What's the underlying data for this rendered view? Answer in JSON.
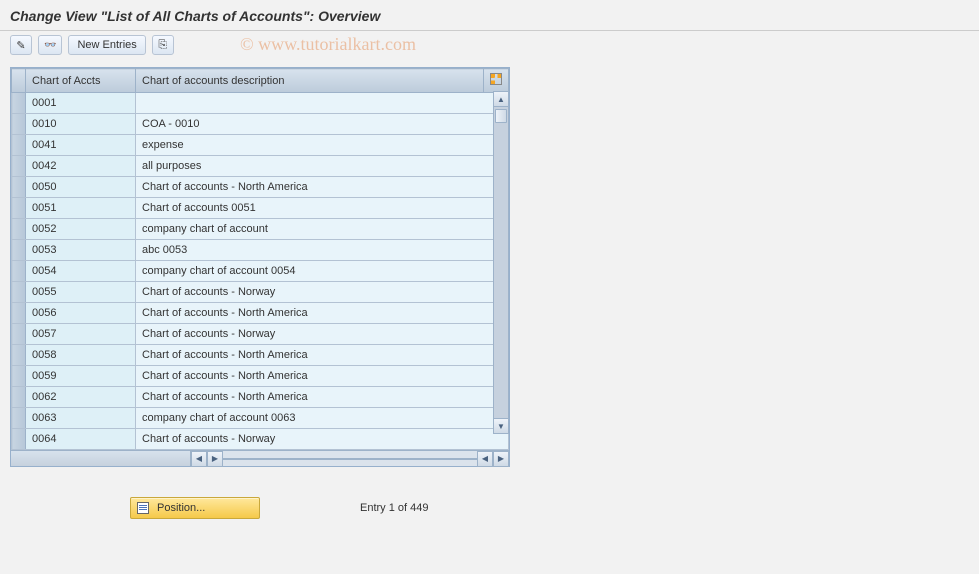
{
  "title": "Change View \"List of All Charts of Accounts\": Overview",
  "watermark": "© www.tutorialkart.com",
  "toolbar": {
    "new_entries_label": "New Entries"
  },
  "columns": {
    "code": "Chart of Accts",
    "desc": "Chart of accounts description"
  },
  "rows": [
    {
      "code": "0001",
      "desc": ""
    },
    {
      "code": "0010",
      "desc": "COA - 0010"
    },
    {
      "code": "0041",
      "desc": "expense"
    },
    {
      "code": "0042",
      "desc": "all purposes"
    },
    {
      "code": "0050",
      "desc": "Chart of accounts - North America"
    },
    {
      "code": "0051",
      "desc": "Chart of accounts 0051"
    },
    {
      "code": "0052",
      "desc": "company chart of account"
    },
    {
      "code": "0053",
      "desc": "abc 0053"
    },
    {
      "code": "0054",
      "desc": "company chart of account 0054"
    },
    {
      "code": "0055",
      "desc": "Chart of accounts - Norway"
    },
    {
      "code": "0056",
      "desc": "Chart of accounts - North America"
    },
    {
      "code": "0057",
      "desc": "Chart of accounts - Norway"
    },
    {
      "code": "0058",
      "desc": "Chart of accounts - North America"
    },
    {
      "code": "0059",
      "desc": "Chart of accounts - North America"
    },
    {
      "code": "0062",
      "desc": "Chart of accounts - North America"
    },
    {
      "code": "0063",
      "desc": "company chart of account 0063"
    },
    {
      "code": "0064",
      "desc": "Chart of accounts - Norway"
    }
  ],
  "footer": {
    "position_label": "Position...",
    "entry_text": "Entry 1 of 449"
  }
}
